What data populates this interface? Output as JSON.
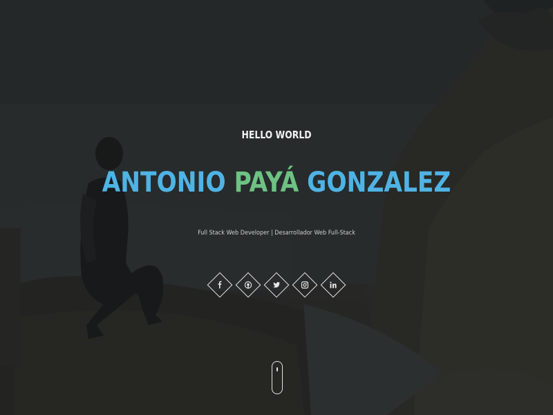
{
  "hero": {
    "greeting": "HELLO WORLD",
    "name_first": "ANTONIO ",
    "name_middle": "PAYÁ",
    "name_last": " GONZALEZ",
    "subtitle": "Full Stack Web Developer | Desarrollador Web Full-Stack"
  },
  "social": [
    {
      "network": "Facebook",
      "icon": "facebook-icon",
      "glyph": "f"
    },
    {
      "network": "GitHub",
      "icon": "github-icon",
      "glyph": ""
    },
    {
      "network": "Twitter",
      "icon": "twitter-icon",
      "glyph": ""
    },
    {
      "network": "Instagram",
      "icon": "instagram-icon",
      "glyph": ""
    },
    {
      "network": "LinkedIn",
      "icon": "linkedin-icon",
      "glyph": "in"
    }
  ],
  "colors": {
    "name_blue": "#4fb3e4",
    "name_green": "#6ec283",
    "text_light": "#f2f2f2"
  },
  "scroll": {
    "icon": "mouse-scroll-icon"
  }
}
